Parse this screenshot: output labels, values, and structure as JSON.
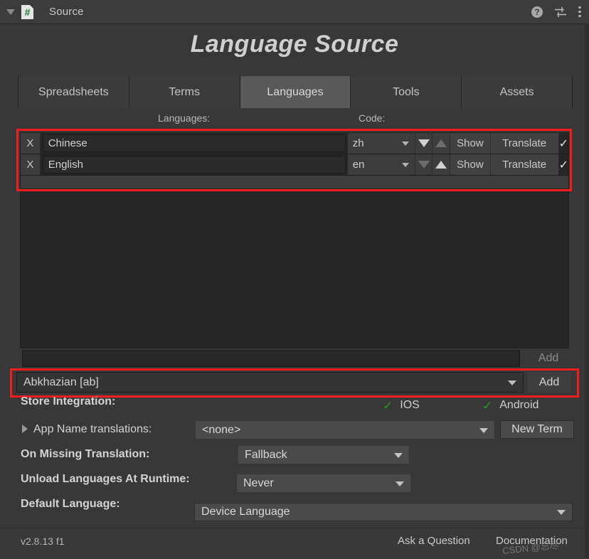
{
  "window": {
    "title": "Source",
    "icon": "csharp-script-icon",
    "foldout": "collapse-triangle",
    "help_icon": "?",
    "preset_icon": "preset-sliders-icon",
    "menu_icon": "kebab-menu-icon"
  },
  "page_title": "Language Source",
  "tabs": [
    {
      "label": "Spreadsheets",
      "active": false
    },
    {
      "label": "Terms",
      "active": false
    },
    {
      "label": "Languages",
      "active": true
    },
    {
      "label": "Tools",
      "active": false
    },
    {
      "label": "Assets",
      "active": false
    }
  ],
  "columns": {
    "languages": "Languages:",
    "code": "Code:"
  },
  "languages": [
    {
      "remove": "X",
      "name": "Chinese",
      "code": "zh",
      "move_down_enabled": true,
      "move_up_enabled": false,
      "show": "Show",
      "translate": "Translate",
      "enabled_check": "✓"
    },
    {
      "remove": "X",
      "name": "English",
      "code": "en",
      "move_down_enabled": false,
      "move_up_enabled": true,
      "show": "Show",
      "translate": "Translate",
      "enabled_check": "✓"
    }
  ],
  "add_empty": {
    "value": "",
    "button": "Add"
  },
  "add_language": {
    "selected": "Abkhazian [ab]",
    "button": "Add"
  },
  "store_integration": {
    "label": "Store Integration:",
    "platforms": [
      {
        "name": "IOS",
        "check": "✓"
      },
      {
        "name": "Android",
        "check": "✓"
      }
    ]
  },
  "app_name": {
    "label": "App Name translations:",
    "value": "<none>",
    "new_term_button": "New Term"
  },
  "on_missing_translation": {
    "label": "On Missing Translation:",
    "value": "Fallback"
  },
  "unload_languages": {
    "label": "Unload Languages At Runtime:",
    "value": "Never"
  },
  "default_language": {
    "label": "Default Language:",
    "value": "Device Language"
  },
  "footer": {
    "version": "v2.8.13 f1",
    "ask": "Ask a Question",
    "documentation": "Documentation",
    "watermark": "CSDN @忘尽"
  },
  "colors": {
    "background": "#383838",
    "panel": "#262626",
    "accent_highlight": "#f61c1c",
    "check_green": "#18a018",
    "tab_active": "#595959"
  }
}
